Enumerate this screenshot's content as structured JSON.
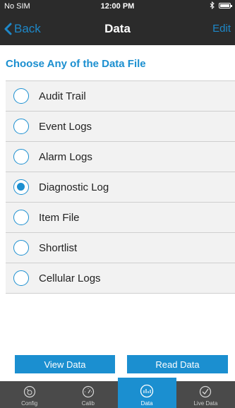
{
  "status_bar": {
    "carrier": "No SIM",
    "time": "12:00 PM"
  },
  "nav": {
    "back_label": "Back",
    "title": "Data",
    "edit_label": "Edit"
  },
  "section_title": "Choose Any of the Data File",
  "items": [
    {
      "label": "Audit Trail",
      "selected": false
    },
    {
      "label": "Event Logs",
      "selected": false
    },
    {
      "label": "Alarm Logs",
      "selected": false
    },
    {
      "label": "Diagnostic Log",
      "selected": true
    },
    {
      "label": "Item File",
      "selected": false
    },
    {
      "label": "Shortlist",
      "selected": false
    },
    {
      "label": "Cellular Logs",
      "selected": false
    }
  ],
  "buttons": {
    "view": "View Data",
    "read": "Read Data"
  },
  "tabs": [
    {
      "label": "Config",
      "icon": "config-gauge-icon",
      "active": false
    },
    {
      "label": "Calib",
      "icon": "calibration-gauge-icon",
      "active": false
    },
    {
      "label": "Data",
      "icon": "data-chart-icon",
      "active": true
    },
    {
      "label": "Live Data",
      "icon": "live-check-icon",
      "active": false
    }
  ],
  "colors": {
    "accent": "#1b8fd0",
    "bar": "#2b2b2b",
    "tabbar": "#4a4a4a"
  }
}
